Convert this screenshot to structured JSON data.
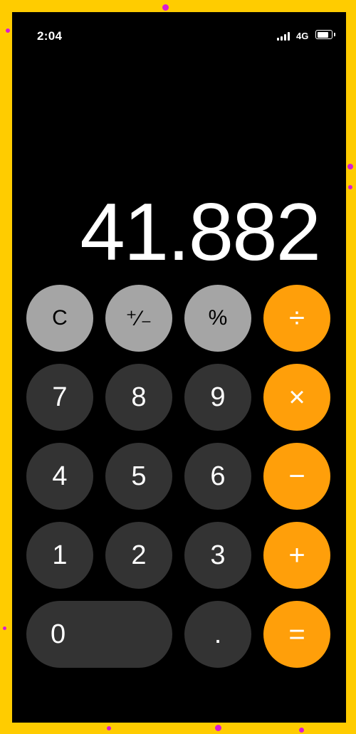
{
  "status_bar": {
    "time": "2:04",
    "network": "4G"
  },
  "display": {
    "value": "41.882"
  },
  "keys": {
    "clear": "C",
    "sign": "⁺∕₋",
    "percent": "%",
    "divide": "÷",
    "seven": "7",
    "eight": "8",
    "nine": "9",
    "multiply": "×",
    "four": "4",
    "five": "5",
    "six": "6",
    "minus": "−",
    "one": "1",
    "two": "2",
    "three": "3",
    "plus": "+",
    "zero": "0",
    "decimal": ".",
    "equals": "="
  },
  "colors": {
    "function_key": "#a5a5a5",
    "number_key": "#333333",
    "operator_key": "#ff9f0a",
    "frame": "#ffcc00"
  },
  "icons": [
    "signal-icon",
    "battery-icon"
  ]
}
